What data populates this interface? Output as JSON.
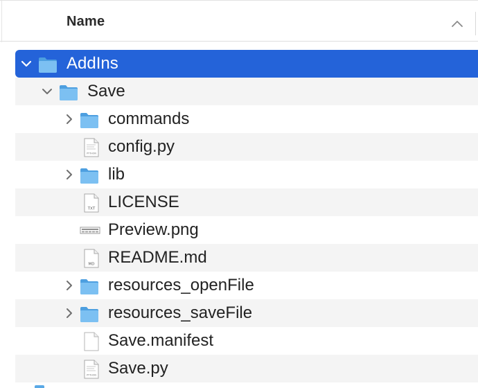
{
  "header": {
    "name_column": "Name",
    "sort_indicator": "chevron-up-icon"
  },
  "rows": [
    {
      "label": "AddIns",
      "kind": "folder",
      "expanded": true,
      "selected": true,
      "level": 0
    },
    {
      "label": "Save",
      "kind": "folder",
      "expanded": true,
      "selected": false,
      "level": 1
    },
    {
      "label": "commands",
      "kind": "folder",
      "expanded": false,
      "selected": false,
      "level": 2
    },
    {
      "label": "config.py",
      "kind": "python-file",
      "badge": "PYTHON",
      "level": 2
    },
    {
      "label": "lib",
      "kind": "folder",
      "expanded": false,
      "selected": false,
      "level": 2
    },
    {
      "label": "LICENSE",
      "kind": "text-file",
      "badge": "TXT",
      "level": 2
    },
    {
      "label": "Preview.png",
      "kind": "image-file",
      "level": 2
    },
    {
      "label": "README.md",
      "kind": "markdown-file",
      "badge": "MD",
      "level": 2
    },
    {
      "label": "resources_openFile",
      "kind": "folder",
      "expanded": false,
      "selected": false,
      "level": 2
    },
    {
      "label": "resources_saveFile",
      "kind": "folder",
      "expanded": false,
      "selected": false,
      "level": 2
    },
    {
      "label": "Save.manifest",
      "kind": "blank-file",
      "level": 2
    },
    {
      "label": "Save.py",
      "kind": "python-file",
      "badge": "PYTHON",
      "level": 2
    }
  ],
  "colors": {
    "selection": "#2463d9",
    "alternate_row": "#f4f4f4",
    "folder_blue": "#6fb6ee"
  }
}
